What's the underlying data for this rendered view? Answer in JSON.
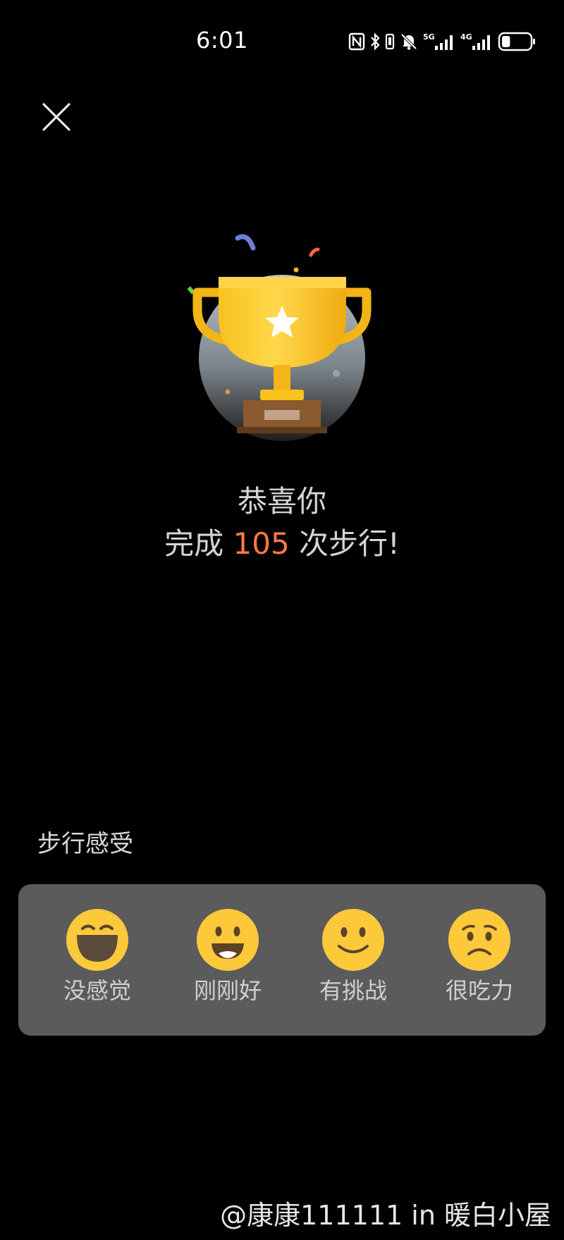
{
  "status_bar": {
    "time": "6:01",
    "icons": [
      "nfc-icon",
      "bluetooth-icon",
      "vibrate-icon",
      "mute-bell-icon",
      "signal-5g-icon",
      "signal-4g-icon",
      "battery-icon"
    ],
    "network_1": "5G",
    "network_2": "4G",
    "battery_level": 0.3
  },
  "close_icon": "close-icon",
  "trophy_icon": "trophy-icon",
  "congrats": {
    "line1": "恭喜你",
    "line2_prefix": "完成",
    "count": "105",
    "line2_suffix": "次步行!",
    "count_color": "#ff7a45"
  },
  "feeling": {
    "title": "步行感受",
    "options": [
      {
        "label": "没感觉",
        "icon": "laughing-face-icon"
      },
      {
        "label": "刚刚好",
        "icon": "grinning-face-icon"
      },
      {
        "label": "有挑战",
        "icon": "smiling-face-icon"
      },
      {
        "label": "很吃力",
        "icon": "worried-face-icon"
      }
    ]
  },
  "watermark": "@康康111111 in 暖白小屋"
}
